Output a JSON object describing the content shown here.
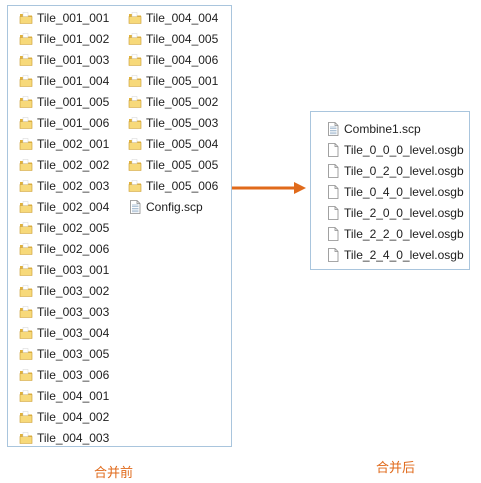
{
  "before": {
    "caption": "合并前",
    "col1": [
      "Tile_001_001",
      "Tile_001_002",
      "Tile_001_003",
      "Tile_001_004",
      "Tile_001_005",
      "Tile_001_006",
      "Tile_002_001",
      "Tile_002_002",
      "Tile_002_003",
      "Tile_002_004",
      "Tile_002_005",
      "Tile_002_006",
      "Tile_003_001",
      "Tile_003_002",
      "Tile_003_003",
      "Tile_003_004",
      "Tile_003_005",
      "Tile_003_006",
      "Tile_004_001",
      "Tile_004_002",
      "Tile_004_003"
    ],
    "col2": [
      "Tile_004_004",
      "Tile_004_005",
      "Tile_004_006",
      "Tile_005_001",
      "Tile_005_002",
      "Tile_005_003",
      "Tile_005_004",
      "Tile_005_005",
      "Tile_005_006"
    ],
    "config_file": "Config.scp",
    "folder_icon": "folder-icon"
  },
  "after": {
    "caption": "合并后",
    "files": [
      "Combine1.scp",
      "Tile_0_0_0_level.osgb",
      "Tile_0_2_0_level.osgb",
      "Tile_0_4_0_level.osgb",
      "Tile_2_0_0_level.osgb",
      "Tile_2_2_0_level.osgb",
      "Tile_2_4_0_level.osgb"
    ],
    "file_icons": [
      "scp-file-icon",
      "blank-file-icon",
      "blank-file-icon",
      "blank-file-icon",
      "blank-file-icon",
      "blank-file-icon",
      "blank-file-icon"
    ]
  },
  "colors": {
    "arrow": "#e06a1b",
    "caption": "#e06a1b",
    "panel_border": "#a9c5dd",
    "folder_light": "#f7d97a",
    "folder_dark": "#e0b23d"
  }
}
